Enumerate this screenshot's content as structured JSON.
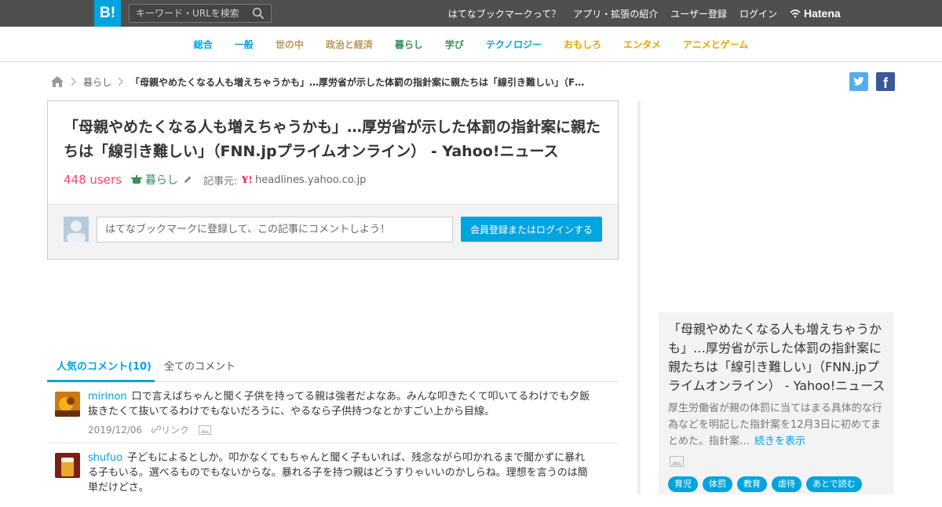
{
  "header": {
    "logo": "B!",
    "search_placeholder": "キーワード・URLを検索",
    "nav": [
      "はてなブックマークって？",
      "アプリ・拡張の紹介",
      "ユーザー登録",
      "ログイン"
    ],
    "brand": "Hatena"
  },
  "categories": [
    {
      "label": "総合",
      "color": "#00a4de"
    },
    {
      "label": "一般",
      "color": "#00a4de"
    },
    {
      "label": "世の中",
      "color": "#b9965b"
    },
    {
      "label": "政治と経済",
      "color": "#b9965b"
    },
    {
      "label": "暮らし",
      "color": "#3c8f5b"
    },
    {
      "label": "学び",
      "color": "#3c8f5b"
    },
    {
      "label": "テクノロジー",
      "color": "#00a4de"
    },
    {
      "label": "おもしろ",
      "color": "#e9a300"
    },
    {
      "label": "エンタメ",
      "color": "#e9a300"
    },
    {
      "label": "アニメとゲーム",
      "color": "#e9a300"
    }
  ],
  "breadcrumb": {
    "category": "暮らし",
    "title": "「母親やめたくなる人も増えちゃうかも」…厚労省が示した体罰の指針案に親たちは「線引き難しい」（FNN.jpプライムオンライン） - Yahoo!ニュース"
  },
  "entry": {
    "title": "「母親やめたくなる人も増えちゃうかも」…厚労省が示した体罰の指針案に親たちは「線引き難しい」（FNN.jpプライムオンライン） - Yahoo!ニュース",
    "users": "448 users",
    "category": "暮らし",
    "source_label": "記事元:",
    "source_icon": "Y!",
    "source": "headlines.yahoo.co.jp",
    "comment_placeholder": "はてなブックマークに登録して、この記事にコメントしよう！",
    "login_button": "会員登録またはログインする"
  },
  "tabs": {
    "popular": "人気のコメント(10)",
    "all": "全てのコメント"
  },
  "comments": [
    {
      "user": "mirinon",
      "text": "口で言えばちゃんと聞く子供を持ってる親は強者だよなあ。みんな叩きたくて叩いてるわけでも夕飯抜きたくて抜いてるわけでもないだろうに、やるなら子供持つなとかすごい上から目線。",
      "date": "2019/12/06",
      "link": "リンク"
    },
    {
      "user": "shufuo",
      "text": "子どもによるとしか。叩かなくてもちゃんと聞く子もいれば、残念ながら叩かれるまで聞かずに暴れる子もいる。選べるものでもないからな。暴れる子を持つ親はどうすりゃいいのかしらね。理想を言うのは簡単だけどさ。"
    }
  ],
  "side_card": {
    "title": "「母親やめたくなる人も増えちゃうかも」…厚労省が示した体罰の指針案に親たちは「線引き難しい」（FNN.jpプライムオンライン） - Yahoo!ニュース",
    "description": "厚生労働省が親の体罰に当てはまる具体的な行為などを明記した指針案を12月3日に初めてまとめた。指針案…",
    "more": "続きを表示",
    "tags": [
      "育児",
      "体罰",
      "教育",
      "虐待",
      "あとで読む"
    ]
  },
  "colors": {
    "accent": "#00a4de",
    "users": "#ff4166",
    "topbar": "#4f4f4f"
  }
}
